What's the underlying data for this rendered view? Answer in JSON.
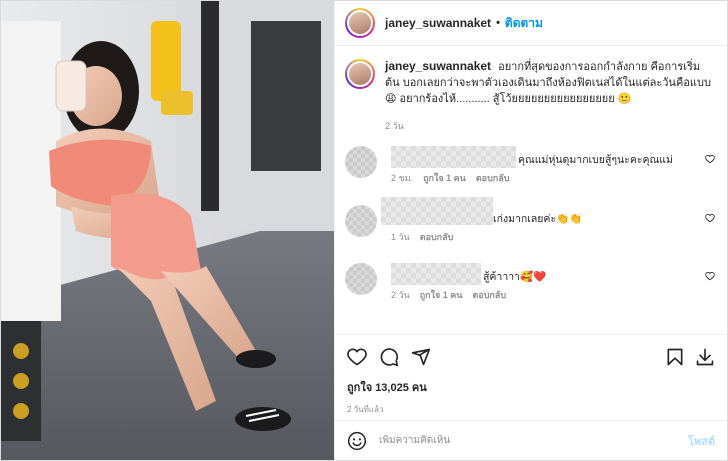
{
  "post": {
    "username": "janey_suwannaket",
    "follow_label": "ติดตาม",
    "dot": "•"
  },
  "caption": {
    "username": "janey_suwannaket",
    "text": "อยากที่สุดของการออกกำลังกาย คือการเริ่มต้น บอกเลยกว่าจะพาตัวเองเดินมาถึงห้องฟิตเนสได้ในแต่ละวันคือแบบ 😩 อยากร้องไห้........... สู้โว้ยยยยยยยยยยยยยยยย 🙂",
    "time": "2 วัน"
  },
  "comments": [
    {
      "text": "คุณแม่หุ่นดุมากเบยสู้ๆนะคะคุณแม่",
      "time": "2 ชม.",
      "likes": "ถูกใจ 1 คน",
      "reply": "ตอบกลับ"
    },
    {
      "text": "เก่งมากเลยค่ะ👏👏",
      "time": "1 วัน",
      "likes": "",
      "reply": "ตอบกลับ"
    },
    {
      "text": "สู้ค้าาาา🥰❤️",
      "time": "2 วัน",
      "likes": "ถูกใจ 1 คน",
      "reply": "ตอบกลับ"
    }
  ],
  "likes_text": "ถูกใจ 13,025 คน",
  "posted_ago": "2 วันที่แล้ว",
  "add_comment": {
    "placeholder": "เพิ่มความคิดเห็น",
    "post_label": "โพสต์"
  },
  "icons": {
    "like": "heart-icon",
    "comment": "comment-icon",
    "share": "share-icon",
    "save": "bookmark-icon",
    "download": "download-icon",
    "emoji": "emoji-icon"
  },
  "colors": {
    "accent": "#0095f6",
    "post_disabled": "#b2dffc",
    "secondary_text": "#8e8e8e",
    "divider": "#efefef"
  }
}
